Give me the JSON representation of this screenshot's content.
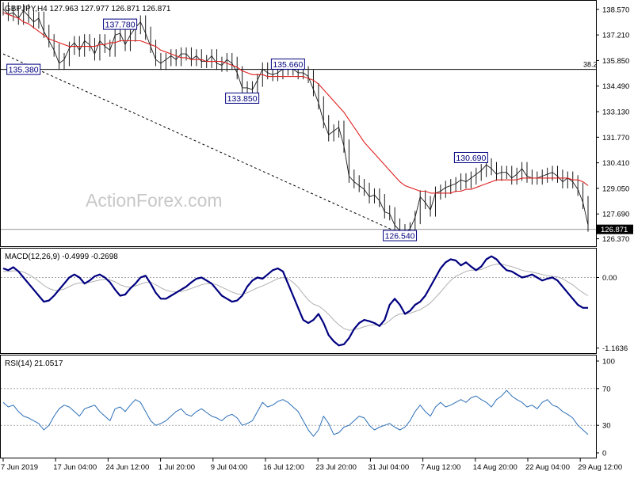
{
  "colors": {
    "price": "#1a1a1a",
    "ema": "#e02020",
    "macd": "#000080",
    "signal": "#b0b0b0",
    "rsi": "#2c6fb8",
    "label_border": "#000080",
    "watermark": "#c8c8c8",
    "grid": "#aaaaaa"
  },
  "watermark": "ActionForex.com",
  "chart_data": [
    {
      "type": "line",
      "panel": "price",
      "title": "GBPJPY,H4  127.963 127.977 126.871 126.871",
      "y_ticks": [
        "138.570",
        "137.210",
        "135.850",
        "134.490",
        "133.130",
        "131.770",
        "130.410",
        "129.050",
        "127.690",
        "126.370"
      ],
      "ylim": [
        126.1,
        138.9
      ],
      "last_price_label": "126.871",
      "fib_label": "38.2",
      "fib_level": 135.38,
      "last_level": 126.871,
      "annotations": [
        {
          "text": "137.780",
          "x": 23,
          "y": 137.78
        },
        {
          "text": "135.380",
          "x": 4,
          "y": 135.38
        },
        {
          "text": "135.660",
          "x": 56,
          "y": 135.66
        },
        {
          "text": "133.850",
          "x": 47,
          "y": 133.85
        },
        {
          "text": "126.540",
          "x": 78,
          "y": 126.54
        },
        {
          "text": "130.690",
          "x": 92,
          "y": 130.69
        }
      ],
      "trendline": [
        [
          0,
          136.2
        ],
        [
          79,
          126.54
        ]
      ],
      "x_count": 116,
      "series": [
        {
          "values": [
            138.6,
            138.3,
            138.4,
            138.1,
            138.5,
            138.2,
            137.9,
            138.1,
            137.4,
            136.9,
            136.4,
            135.7,
            135.9,
            136.5,
            136.8,
            136.4,
            136.9,
            136.7,
            136.2,
            136.9,
            136.6,
            136.4,
            137.2,
            137.3,
            136.7,
            137.2,
            137.6,
            137.9,
            137.3,
            136.6,
            135.9,
            135.7,
            135.9,
            136.1,
            135.9,
            136.2,
            136.2,
            135.9,
            136.1,
            135.8,
            135.8,
            136.1,
            135.7,
            135.6,
            135.9,
            135.7,
            135.2,
            134.4,
            134.4,
            134.3,
            134.8,
            135.4,
            135.2,
            135.1,
            135.2,
            135.4,
            135.5,
            135.4,
            135.2,
            135.2,
            135.0,
            134.3,
            133.6,
            132.6,
            131.9,
            132.1,
            132.3,
            131.3,
            129.7,
            129.4,
            129.2,
            129.0,
            128.6,
            128.7,
            128.4,
            127.8,
            127.7,
            127.1,
            126.8,
            126.7,
            126.9,
            127.5,
            128.6,
            128.3,
            127.9,
            128.8,
            128.9,
            129.1,
            129.2,
            129.3,
            129.5,
            129.4,
            129.6,
            129.8,
            130.0,
            130.3,
            130.1,
            129.8,
            129.9,
            129.9,
            129.6,
            129.8,
            130.1,
            129.7,
            129.6,
            129.6,
            129.7,
            129.8,
            129.9,
            129.7,
            129.4,
            129.6,
            129.4,
            129.0,
            128.3,
            127.1
          ]
        },
        {
          "values": [
            138.4,
            138.3,
            138.2,
            138.1,
            137.9,
            137.8,
            137.6,
            137.4,
            137.2,
            137.0,
            136.9,
            136.8,
            136.7,
            136.6,
            136.6,
            136.6,
            136.6,
            136.6,
            136.6,
            136.7,
            136.7,
            136.8,
            136.8,
            136.9,
            136.9,
            136.9,
            136.9,
            136.9,
            136.8,
            136.7,
            136.6,
            136.4,
            136.3,
            136.2,
            136.1,
            136.0,
            136.0,
            135.9,
            135.9,
            135.9,
            135.8,
            135.8,
            135.8,
            135.8,
            135.7,
            135.6,
            135.5,
            135.3,
            135.2,
            135.1,
            135.1,
            135.1,
            135.0,
            135.0,
            135.0,
            135.0,
            135.0,
            135.0,
            135.0,
            135.0,
            134.9,
            134.8,
            134.6,
            134.3,
            134.0,
            133.7,
            133.4,
            133.1,
            132.7,
            132.3,
            131.9,
            131.5,
            131.2,
            130.9,
            130.6,
            130.3,
            130.0,
            129.7,
            129.4,
            129.2,
            129.1,
            129.0,
            128.9,
            128.9,
            128.8,
            128.8,
            128.8,
            128.8,
            128.8,
            128.9,
            128.9,
            129.0,
            129.0,
            129.1,
            129.2,
            129.3,
            129.4,
            129.5,
            129.5,
            129.5,
            129.5,
            129.5,
            129.6,
            129.6,
            129.6,
            129.6,
            129.6,
            129.6,
            129.6,
            129.6,
            129.6,
            129.6,
            129.5,
            129.5,
            129.4,
            129.2
          ]
        }
      ]
    },
    {
      "type": "line",
      "panel": "macd",
      "title": "MACD(12,26,9) -0.4999 -0.2698",
      "y_ticks": [
        "0.00",
        "-1.1636"
      ],
      "ylim": [
        -1.22,
        0.45
      ],
      "series": [
        {
          "values": [
            0.15,
            0.12,
            0.17,
            0.1,
            0.0,
            -0.1,
            -0.2,
            -0.3,
            -0.4,
            -0.38,
            -0.3,
            -0.2,
            -0.1,
            0.0,
            0.05,
            0.0,
            -0.1,
            -0.05,
            0.02,
            0.05,
            0.0,
            -0.08,
            -0.2,
            -0.3,
            -0.28,
            -0.18,
            -0.1,
            0.0,
            0.03,
            -0.1,
            -0.25,
            -0.35,
            -0.35,
            -0.3,
            -0.25,
            -0.2,
            -0.15,
            -0.08,
            -0.02,
            0.0,
            -0.05,
            -0.1,
            -0.2,
            -0.3,
            -0.35,
            -0.4,
            -0.38,
            -0.3,
            -0.15,
            -0.05,
            0.0,
            -0.02,
            0.05,
            0.12,
            0.15,
            0.1,
            -0.1,
            -0.3,
            -0.5,
            -0.7,
            -0.75,
            -0.7,
            -0.6,
            -0.75,
            -0.95,
            -1.05,
            -1.12,
            -1.1,
            -1.0,
            -0.85,
            -0.75,
            -0.7,
            -0.72,
            -0.75,
            -0.8,
            -0.7,
            -0.45,
            -0.35,
            -0.45,
            -0.6,
            -0.55,
            -0.45,
            -0.4,
            -0.3,
            -0.15,
            0.0,
            0.15,
            0.25,
            0.3,
            0.28,
            0.2,
            0.25,
            0.18,
            0.12,
            0.18,
            0.3,
            0.35,
            0.3,
            0.2,
            0.12,
            0.1,
            0.05,
            0.0,
            0.02,
            0.05,
            0.0,
            -0.05,
            -0.02,
            0.0,
            -0.05,
            -0.15,
            -0.25,
            -0.35,
            -0.45,
            -0.5,
            -0.5
          ]
        },
        {
          "values": [
            0.1,
            0.1,
            0.11,
            0.11,
            0.09,
            0.05,
            0.0,
            -0.06,
            -0.13,
            -0.18,
            -0.21,
            -0.21,
            -0.19,
            -0.15,
            -0.11,
            -0.09,
            -0.09,
            -0.08,
            -0.06,
            -0.04,
            -0.03,
            -0.04,
            -0.07,
            -0.12,
            -0.15,
            -0.16,
            -0.14,
            -0.11,
            -0.08,
            -0.08,
            -0.12,
            -0.17,
            -0.21,
            -0.23,
            -0.24,
            -0.23,
            -0.21,
            -0.18,
            -0.15,
            -0.12,
            -0.1,
            -0.1,
            -0.12,
            -0.16,
            -0.2,
            -0.24,
            -0.27,
            -0.28,
            -0.25,
            -0.21,
            -0.17,
            -0.14,
            -0.1,
            -0.06,
            -0.02,
            0.0,
            -0.02,
            -0.08,
            -0.16,
            -0.27,
            -0.37,
            -0.44,
            -0.47,
            -0.53,
            -0.61,
            -0.7,
            -0.78,
            -0.84,
            -0.87,
            -0.86,
            -0.84,
            -0.81,
            -0.79,
            -0.78,
            -0.78,
            -0.77,
            -0.71,
            -0.64,
            -0.6,
            -0.6,
            -0.59,
            -0.56,
            -0.53,
            -0.48,
            -0.42,
            -0.33,
            -0.24,
            -0.14,
            -0.05,
            0.02,
            0.06,
            0.1,
            0.12,
            0.12,
            0.13,
            0.17,
            0.2,
            0.22,
            0.22,
            0.2,
            0.18,
            0.15,
            0.12,
            0.1,
            0.09,
            0.07,
            0.05,
            0.03,
            0.02,
            0.01,
            -0.02,
            -0.07,
            -0.12,
            -0.19,
            -0.25,
            -0.3
          ]
        }
      ]
    },
    {
      "type": "line",
      "panel": "rsi",
      "title": "RSI(14) 21.0517",
      "y_ticks": [
        "100",
        "70",
        "30",
        "0"
      ],
      "ylim": [
        0,
        100
      ],
      "levels": [
        70,
        30
      ],
      "series": [
        {
          "values": [
            55,
            50,
            52,
            45,
            40,
            38,
            35,
            32,
            25,
            30,
            40,
            48,
            52,
            50,
            45,
            40,
            48,
            50,
            52,
            45,
            40,
            35,
            48,
            50,
            45,
            52,
            58,
            55,
            45,
            35,
            30,
            32,
            35,
            40,
            45,
            48,
            42,
            40,
            45,
            48,
            44,
            40,
            38,
            35,
            40,
            42,
            38,
            30,
            32,
            35,
            45,
            55,
            50,
            52,
            56,
            58,
            55,
            50,
            45,
            35,
            25,
            18,
            25,
            40,
            32,
            20,
            22,
            28,
            30,
            35,
            40,
            38,
            30,
            25,
            28,
            30,
            32,
            28,
            25,
            28,
            35,
            45,
            52,
            45,
            40,
            50,
            55,
            50,
            52,
            55,
            58,
            55,
            60,
            62,
            58,
            55,
            50,
            58,
            62,
            68,
            62,
            58,
            55,
            50,
            52,
            48,
            55,
            58,
            52,
            50,
            45,
            42,
            38,
            30,
            25,
            20
          ]
        }
      ]
    },
    {
      "type": "line",
      "panel": "x-axis",
      "x_tick_labels": [
        "7 Jun 2019",
        "17 Jun 04:00",
        "24 Jun 12:00",
        "1 Jul 20:00",
        "9 Jul 04:00",
        "16 Jul 12:00",
        "23 Jul 20:00",
        "31 Jul 04:00",
        "7 Aug 12:00",
        "14 Aug 20:00",
        "22 Aug 04:00",
        "29 Aug 12:00"
      ]
    }
  ]
}
